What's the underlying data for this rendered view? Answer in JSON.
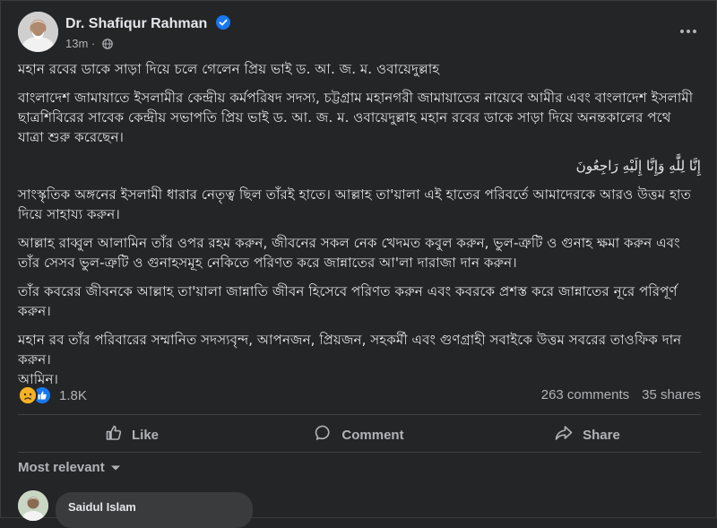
{
  "post": {
    "author": "Dr. Shafiqur Rahman",
    "time": "13m",
    "paragraphs": [
      "মহান রবের ডাকে সাড়া দিয়ে চলে গেলেন প্রিয় ভাই ড. আ. জ. ম. ওবায়েদুল্লাহ",
      "বাংলাদেশ জামায়াতে ইসলামীর কেন্দ্রীয় কর্মপরিষদ সদস্য, চট্টগ্রাম মহানগরী জামায়াতের নায়েবে আমীর এবং বাংলাদেশ ইসলামী ছাত্রশিবিরের সাবেক কেন্দ্রীয় সভাপতি প্রিয় ভাই ড. আ. জ. ম. ওবায়েদুল্লাহ মহান রবের ডাকে সাড়া দিয়ে অনন্তকালের পথে যাত্রা শুরু করেছেন।",
      "إِنَّا لِلَّٰهِ وَإِنَّا إِلَيْهِ رَاجِعُونَ",
      "সাংস্কৃতিক অঙ্গনের ইসলামী ধারার নেতৃত্ব ছিল তাঁরই হাতে। আল্লাহ তা'য়ালা এই হাতের পরিবর্তে আমাদেরকে আরও উত্তম হাত দিয়ে সাহায্য করুন।",
      "আল্লাহ রাব্বুল আলামিন তাঁর ওপর রহম করুন, জীবনের সকল নেক খেদমত কবুল করুন, ভুল-ত্রুটি ও গুনাহ ক্ষমা করুন এবং তাঁর সেসব ভুল-ত্রুটি ও গুনাহসমূহ নেকিতে পরিণত করে জান্নাতের আ'লা দারাজা দান করুন।",
      "তাঁর কবরের জীবনকে আল্লাহ তা'য়ালা জান্নাতি জীবন হিসেবে পরিণত করুন এবং কবরকে প্রশস্ত করে জান্নাতের নূরে পরিপূর্ণ করুন।",
      "মহান রব তাঁর পরিবারের সম্মানিত সদস্যবৃন্দ, আপনজন, প্রিয়জন, সহকর্মী এবং গুণগ্রাহী সবাইকে উত্তম সবরের তাওফিক দান করুন।",
      "আমিন।"
    ]
  },
  "stats": {
    "reaction_count": "1.8K",
    "comments": "263 comments",
    "shares": "35 shares"
  },
  "actions": {
    "like": "Like",
    "comment": "Comment",
    "share": "Share"
  },
  "comments_section": {
    "sort_label": "Most relevant",
    "first_commenter": "Saidul Islam"
  },
  "colors": {
    "background": "#242526",
    "text_primary": "#e4e6eb",
    "text_secondary": "#b0b3b8",
    "verified_badge": "#1877f2",
    "like_reaction": "#1877f2",
    "sad_reaction": "#f7b125"
  }
}
